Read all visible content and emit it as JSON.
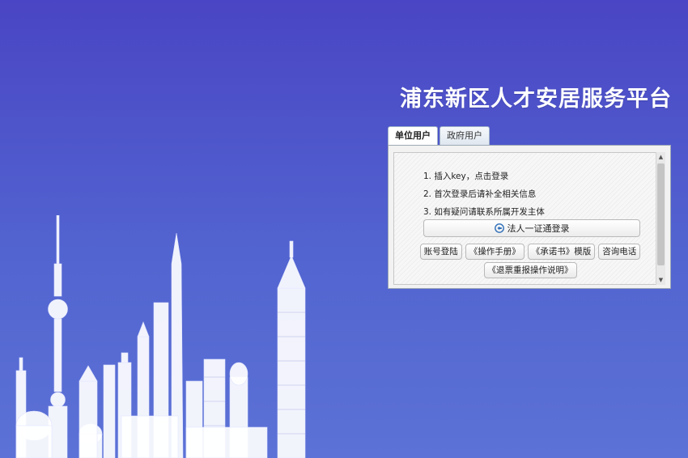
{
  "platform": {
    "title": "浦东新区人才安居服务平台"
  },
  "tabs": [
    {
      "label": "单位用户",
      "active": true
    },
    {
      "label": "政府用户",
      "active": false
    }
  ],
  "instructions": [
    "1. 插入key，点击登录",
    "2. 首次登录后请补全相关信息",
    "3. 如有疑问请联系所属开发主体"
  ],
  "login_button": {
    "label": "法人一证通登录",
    "icon": "key-login-icon"
  },
  "links": [
    "账号登陆",
    "《操作手册》",
    "《承诺书》模版",
    "咨询电话",
    "《退票重报操作说明》"
  ],
  "colors": {
    "background_top": "#4a45c4",
    "background_bottom": "#5c72d6",
    "title_text": "#ffffff",
    "skyline": "#ffffff"
  }
}
